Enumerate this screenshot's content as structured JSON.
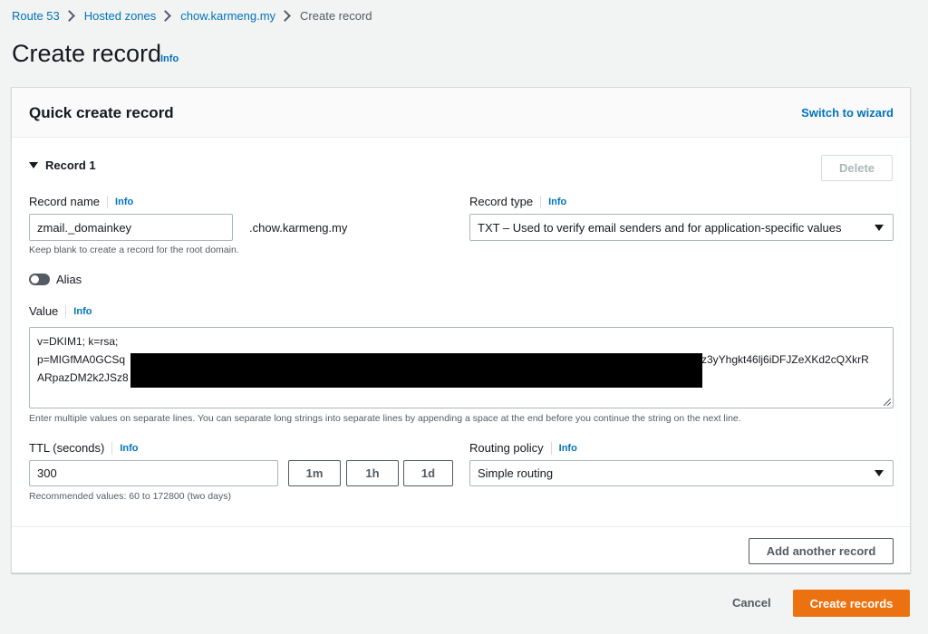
{
  "breadcrumb": {
    "items": [
      "Route 53",
      "Hosted zones",
      "chow.karmeng.my"
    ],
    "current": "Create record"
  },
  "page": {
    "title": "Create record",
    "info": "Info"
  },
  "panel": {
    "title": "Quick create record",
    "switch_label": "Switch to wizard",
    "record_heading": "Record 1",
    "delete_label": "Delete",
    "add_another_label": "Add another record"
  },
  "record_name": {
    "label": "Record name",
    "info": "Info",
    "value": "zmail._domainkey",
    "suffix": ".chow.karmeng.my",
    "hint": "Keep blank to create a record for the root domain."
  },
  "record_type": {
    "label": "Record type",
    "info": "Info",
    "value": "TXT – Used to verify email senders and for application-specific values"
  },
  "alias": {
    "label": "Alias",
    "enabled": false
  },
  "value_field": {
    "label": "Value",
    "info": "Info",
    "line1": "v=DKIM1; k=rsa;",
    "line2_start": "p=MIGfMA0GCSq",
    "line2_end": "z3yYhgkt46lj6iDFJZeXKd2cQXkrR",
    "line3_start": "ARpazDM2k2JSz8",
    "hint": "Enter multiple values on separate lines. You can separate long strings into separate lines by appending a space at the end before you continue the string on the next line."
  },
  "ttl": {
    "label": "TTL (seconds)",
    "info": "Info",
    "value": "300",
    "presets": [
      "1m",
      "1h",
      "1d"
    ],
    "hint": "Recommended values: 60 to 172800 (two days)"
  },
  "routing_policy": {
    "label": "Routing policy",
    "info": "Info",
    "value": "Simple routing"
  },
  "footer": {
    "cancel_label": "Cancel",
    "create_label": "Create records"
  },
  "colors": {
    "link": "#0073bb",
    "primary": "#ec7211",
    "background": "#f2f3f3"
  }
}
